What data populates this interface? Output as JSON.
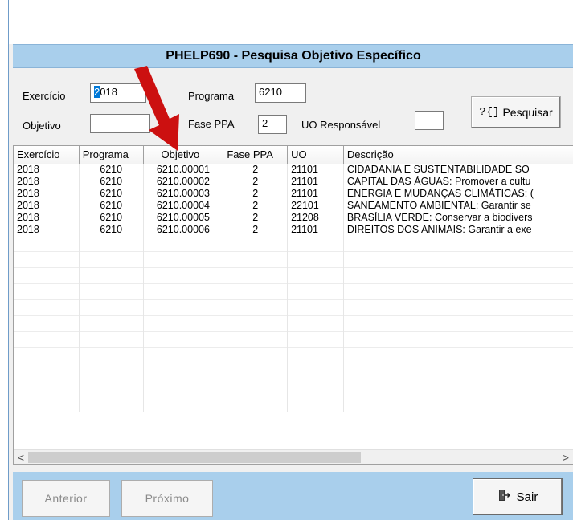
{
  "window": {
    "title": "PHELP690 - Pesquisa Objetivo Específico"
  },
  "filters": {
    "exercicio_label": "Exercício",
    "exercicio_value": "2018",
    "programa_label": "Programa",
    "programa_value": "6210",
    "objetivo_label": "Objetivo",
    "objetivo_value": "",
    "fase_label": "Fase PPA",
    "fase_value": "2",
    "uo_label": "UO Responsável",
    "uo_value": "",
    "search_icon": "?{]",
    "search_label": "Pesquisar"
  },
  "table": {
    "headers": [
      "Exercício",
      "Programa",
      "Objetivo",
      "Fase PPA",
      "UO",
      "Descrição"
    ],
    "rows": [
      [
        "2018",
        "6210",
        "6210.00001",
        "2",
        "21101",
        "CIDADANIA E SUSTENTABILIDADE SO"
      ],
      [
        "2018",
        "6210",
        "6210.00002",
        "2",
        "21101",
        "CAPITAL DAS ÁGUAS: Promover a cultu"
      ],
      [
        "2018",
        "6210",
        "6210.00003",
        "2",
        "21101",
        "ENERGIA E MUDANÇAS CLIMÁTICAS: ("
      ],
      [
        "2018",
        "6210",
        "6210.00004",
        "2",
        "22101",
        "SANEAMENTO AMBIENTAL: Garantir se"
      ],
      [
        "2018",
        "6210",
        "6210.00005",
        "2",
        "21208",
        "BRASÍLIA VERDE: Conservar a biodivers"
      ],
      [
        "2018",
        "6210",
        "6210.00006",
        "2",
        "21101",
        "DIREITOS DOS ANIMAIS: Garantir a exe"
      ]
    ]
  },
  "scroll": {
    "left_arrow": "<",
    "right_arrow": ">"
  },
  "footer": {
    "prev_label": "Anterior",
    "next_label": "Próximo",
    "exit_label": "Sair",
    "exit_icon": "door-exit-icon"
  },
  "annotation": {
    "arrow_color": "#cc1010"
  }
}
